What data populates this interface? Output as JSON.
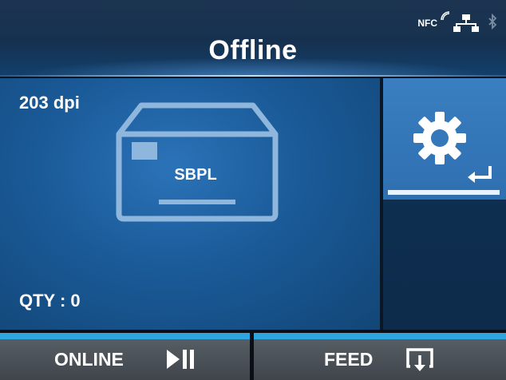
{
  "header": {
    "title": "Offline",
    "status": {
      "nfc_label": "NFC",
      "icons": [
        "nfc-icon",
        "network-icon",
        "bluetooth-icon"
      ]
    }
  },
  "main": {
    "resolution": "203 dpi",
    "printer_language": "SBPL",
    "quantity": "QTY : 0"
  },
  "settings": {
    "icons": [
      "gear-icon",
      "enter-icon"
    ]
  },
  "softkeys": {
    "online": {
      "label": "ONLINE",
      "icon": "play-pause-icon"
    },
    "feed": {
      "label": "FEED",
      "icon": "feed-icon"
    }
  },
  "colors": {
    "accent": "#2fa6e0",
    "panel_blue": "#1a5a98",
    "header_dark": "#16314f",
    "softkey_gray": "#4c5258"
  }
}
